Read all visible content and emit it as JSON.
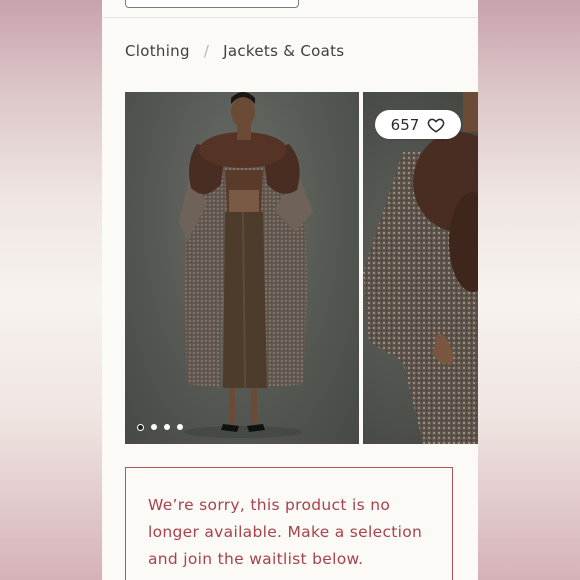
{
  "breadcrumb": {
    "items": [
      "Clothing",
      "Jackets & Coats"
    ],
    "separator": "/"
  },
  "product": {
    "favorites_count": "657",
    "gallery_dot_count": 4,
    "gallery_active_dot": 1
  },
  "notice": {
    "message": "We’re sorry, this product is no longer available. Make a selection and join the waitlist below."
  },
  "colors": {
    "notice_accent": "#b2545e",
    "page_background": "#fbfaf7"
  }
}
